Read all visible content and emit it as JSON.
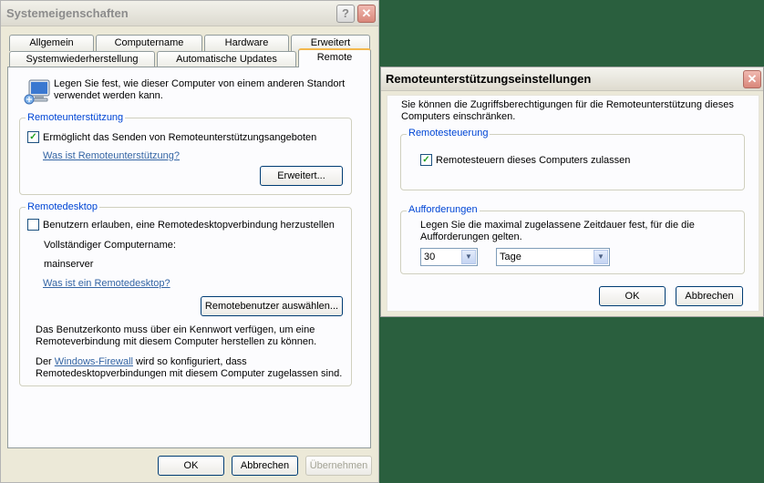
{
  "system_props": {
    "title": "Systemeigenschaften",
    "help_glyph": "?",
    "close_glyph": "✕",
    "tabs_row1": [
      "Allgemein",
      "Computername",
      "Hardware",
      "Erweitert"
    ],
    "tabs_row2": [
      "Systemwiederherstellung",
      "Automatische Updates",
      "Remote"
    ],
    "intro_line1": "Legen Sie fest, wie dieser Computer von einem anderen Standort",
    "intro_line2": "verwendet werden kann.",
    "remote_assistance": {
      "group_title": "Remoteunterstützung",
      "checkbox_label": "Ermöglicht das Senden von Remoteunterstützungsangeboten",
      "checkbox_checked": true,
      "link": "Was ist Remoteunterstützung?",
      "advanced_button": "Erweitert..."
    },
    "remote_desktop": {
      "group_title": "Remotedesktop",
      "checkbox_label": "Benutzern erlauben, eine Remotedesktopverbindung herzustellen",
      "checkbox_checked": false,
      "fullname_label": "Vollständiger Computername:",
      "computer_name": "mainserver",
      "link": "Was ist ein Remotedesktop?",
      "select_users_button": "Remotebenutzer auswählen...",
      "note1_line1": "Das Benutzerkonto muss über ein Kennwort verfügen, um eine",
      "note1_line2": "Remoteverbindung mit diesem Computer herstellen zu können.",
      "note2_prefix": "Der ",
      "note2_link": "Windows-Firewall",
      "note2_suffix": " wird so konfiguriert, dass",
      "note2_line2": "Remotedesktopverbindungen mit diesem Computer zugelassen sind."
    },
    "ok_button": "OK",
    "cancel_button": "Abbrechen",
    "apply_button": "Übernehmen"
  },
  "remote_settings": {
    "title": "Remoteunterstützungseinstellungen",
    "close_glyph": "✕",
    "intro_line1": "Sie können die Zugriffsberechtigungen für die Remoteunterstützung dieses",
    "intro_line2": "Computers einschränken.",
    "remote_control": {
      "group_title": "Remotesteuerung",
      "checkbox_label": "Remotesteuern dieses Computers zulassen",
      "checkbox_checked": true
    },
    "invitations": {
      "group_title": "Aufforderungen",
      "desc_line1": "Legen Sie die maximal zugelassene Zeitdauer fest, für die die",
      "desc_line2": "Aufforderungen gelten.",
      "amount": "30",
      "unit": "Tage"
    },
    "ok_button": "OK",
    "cancel_button": "Abbrechen"
  },
  "colors": {
    "desktop": "#2a5f3e",
    "group_title": "#0046d5",
    "link": "#3465a4",
    "active_tab_accent": "#f3b84c"
  },
  "icons": {
    "pc": "computer-monitor-icon",
    "check": "✓",
    "dropdown": "▼"
  }
}
